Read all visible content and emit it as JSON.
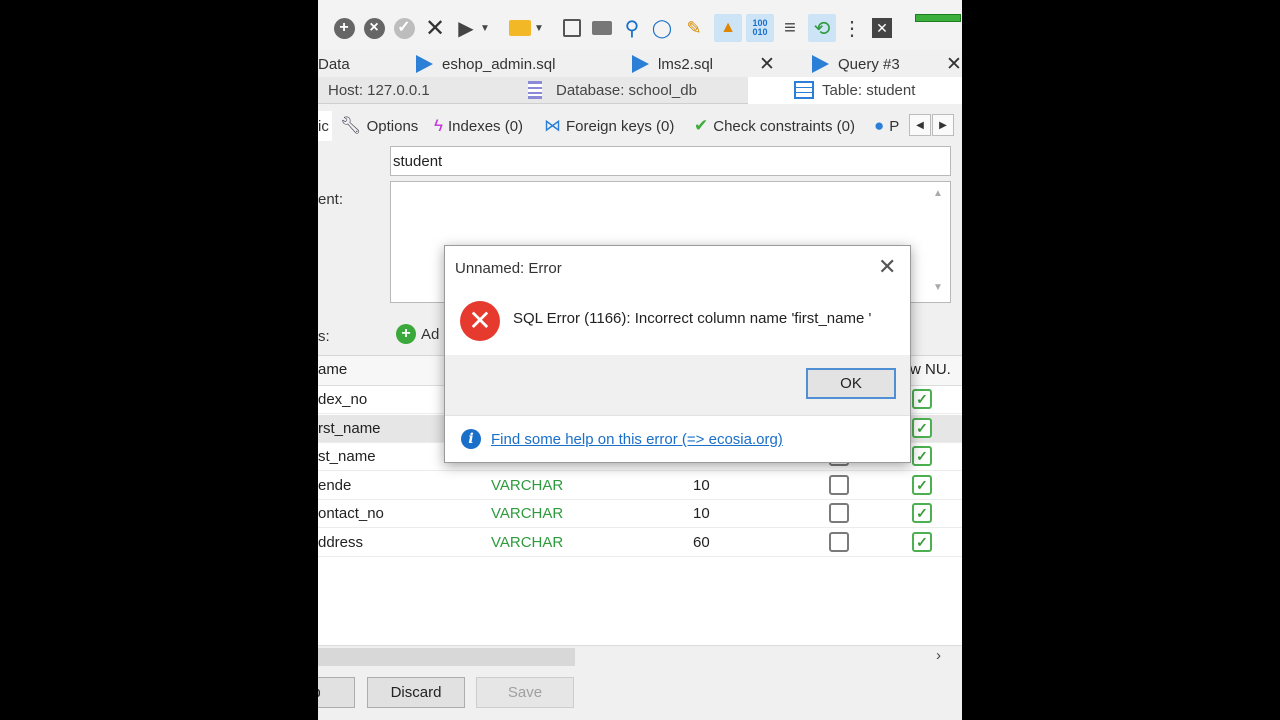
{
  "query_tabs": [
    {
      "label": "Data"
    },
    {
      "label": "eshop_admin.sql"
    },
    {
      "label": "lms2.sql"
    },
    {
      "label": "Query #3"
    }
  ],
  "context": {
    "host": "Host: 127.0.0.1",
    "database": "Database: school_db",
    "table": "Table: student"
  },
  "editor_tabs": [
    {
      "label": "ic"
    },
    {
      "label": "Options"
    },
    {
      "label": "Indexes (0)"
    },
    {
      "label": "Foreign keys (0)"
    },
    {
      "label": "Check constraints (0)"
    },
    {
      "label": "P"
    }
  ],
  "form": {
    "name_value": "student",
    "comment_label": "ent:",
    "columns_label": "s:",
    "add_label": "Ad"
  },
  "grid": {
    "headers": {
      "name": "ame",
      "allow_null": "w NU."
    },
    "rows": [
      {
        "name": "dex_no",
        "type": "",
        "length": "",
        "unsigned": false,
        "allow_null": true
      },
      {
        "name": "rst_name",
        "type": "",
        "length": "",
        "unsigned": false,
        "allow_null": true
      },
      {
        "name": "st_name",
        "type": "",
        "length": "",
        "unsigned": false,
        "allow_null": true
      },
      {
        "name": "ende",
        "type": "VARCHAR",
        "length": "10",
        "unsigned": false,
        "allow_null": true
      },
      {
        "name": "ontact_no",
        "type": "VARCHAR",
        "length": "10",
        "unsigned": false,
        "allow_null": true
      },
      {
        "name": "ddress",
        "type": "VARCHAR",
        "length": "60",
        "unsigned": false,
        "allow_null": true
      }
    ]
  },
  "buttons": {
    "help": "p",
    "discard": "Discard",
    "save": "Save"
  },
  "dialog": {
    "title": "Unnamed: Error",
    "message": "SQL Error (1166): Incorrect column name 'first_name '",
    "ok": "OK",
    "help_link": "Find some help on this error (=> ecosia.org)"
  },
  "colors": {
    "accent": "#2b7fd6",
    "error": "#e53a2d",
    "type_green": "#2e9b3d",
    "link": "#1a6fc9"
  }
}
